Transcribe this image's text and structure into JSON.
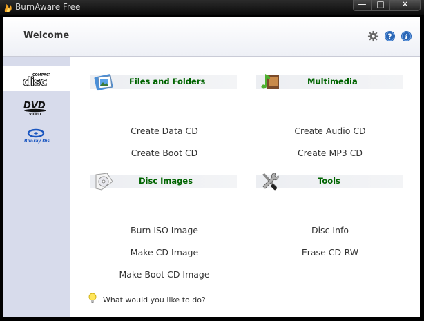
{
  "window": {
    "title": "BurnAware Free",
    "minimize_glyph": "—",
    "maximize_glyph": "□",
    "close_glyph": "✕"
  },
  "header": {
    "title": "Welcome",
    "icons": [
      "gear-icon",
      "help-icon",
      "info-icon"
    ]
  },
  "sidebar": {
    "items": [
      {
        "id": "cd",
        "icon": "compact-disc-logo-icon",
        "active": true
      },
      {
        "id": "dvd",
        "icon": "dvd-video-logo-icon",
        "active": false
      },
      {
        "id": "bluray",
        "icon": "blu-ray-disc-logo-icon",
        "active": false
      }
    ]
  },
  "sections": [
    {
      "id": "files",
      "title": "Files and Folders",
      "icon": "folder-documents-icon",
      "links": [
        "Create Data CD",
        "Create Boot CD"
      ]
    },
    {
      "id": "multimedia",
      "title": "Multimedia",
      "icon": "music-note-film-icon",
      "links": [
        "Create Audio CD",
        "Create MP3 CD"
      ]
    },
    {
      "id": "images",
      "title": "Disc Images",
      "icon": "disc-image-icon",
      "links": [
        "Burn ISO Image",
        "Make CD Image",
        "Make Boot CD Image"
      ]
    },
    {
      "id": "tools",
      "title": "Tools",
      "icon": "wrench-screwdriver-icon",
      "links": [
        "Disc Info",
        "Erase CD-RW"
      ]
    }
  ],
  "footer": {
    "hint": "What would you like to do?",
    "icon": "lightbulb-icon"
  },
  "colors": {
    "section_title": "#006400",
    "sidebar_bg": "#d7dbeb",
    "titlebar_bg": "#0a0a0a",
    "accent_blue": "#2a66b5"
  }
}
